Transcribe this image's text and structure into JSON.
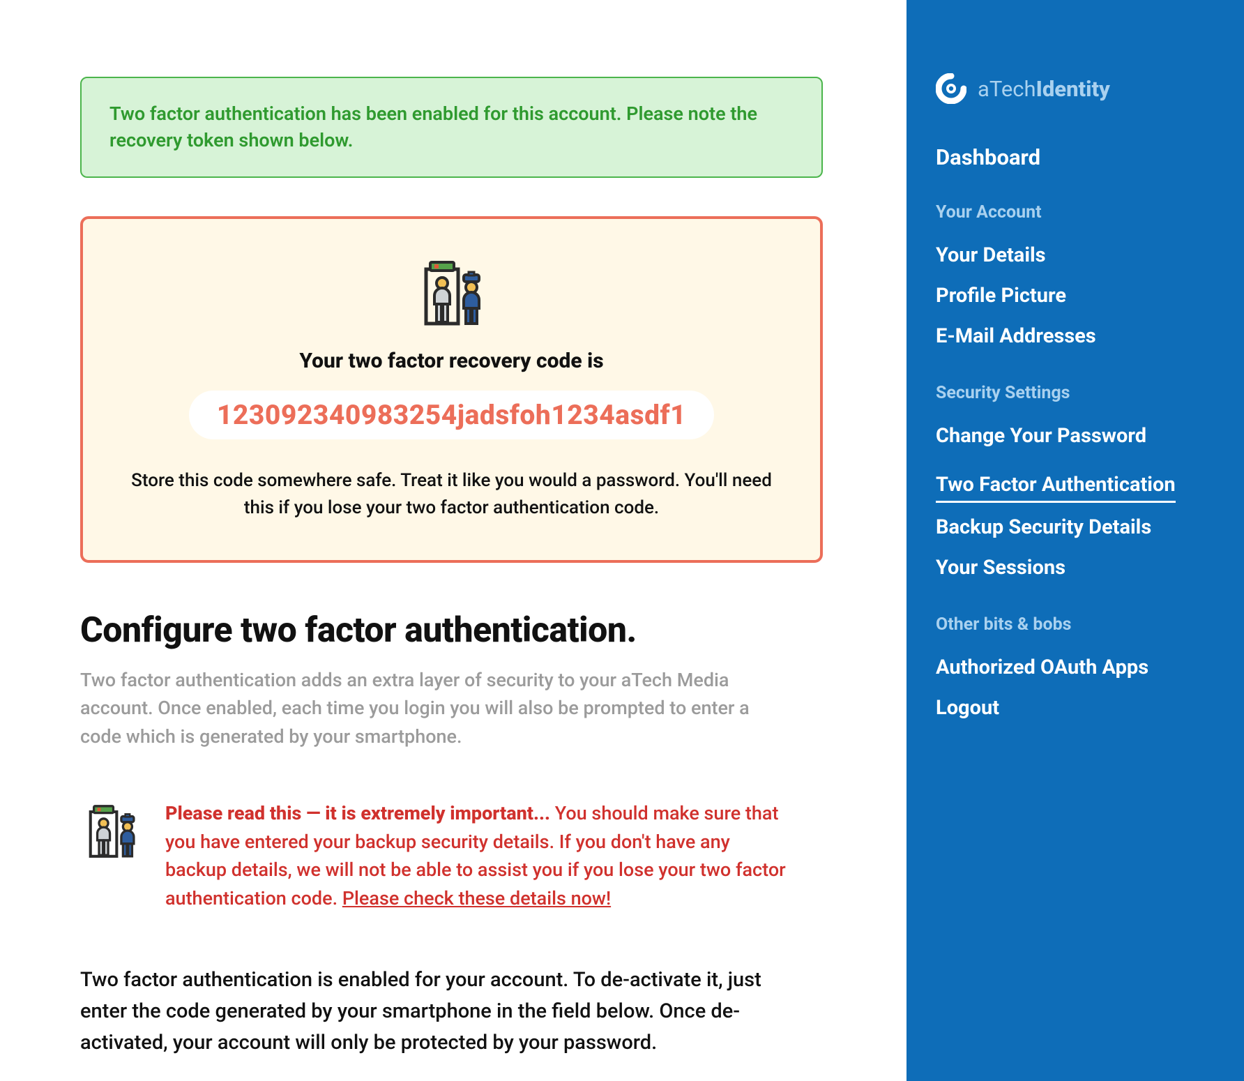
{
  "alert": {
    "text": "Two factor authentication has been enabled for this account. Please note the recovery token shown below."
  },
  "recovery": {
    "title": "Your two factor recovery code is",
    "code": "123092340983254jadsfoh1234asdf1",
    "note": "Store this code somewhere safe. Treat it like you would a password. You'll need this if you lose your two factor authentication code."
  },
  "page": {
    "title": "Configure two factor authentication.",
    "intro": "Two factor authentication adds an extra layer of security to your aTech Media account. Once enabled, each time you login you will also be prompted to enter a code which is generated by your smartphone."
  },
  "warn": {
    "lead": "Please read this — it is extremely important...",
    "body": " You should make sure that you have entered your backup security details. If you don't have any backup details, we will not be able to assist you if you lose your two factor authentication code. ",
    "link": "Please check these details now!"
  },
  "deactivate": {
    "text": "Two factor authentication is enabled for your account. To de-activate it, just enter the code generated by your smartphone in the field below. Once de-activated, your account will only be protected by your password."
  },
  "sidebar": {
    "brand_a": "aTech",
    "brand_b": "Identity",
    "dashboard": "Dashboard",
    "sections": {
      "account": {
        "label": "Your Account",
        "items": [
          "Your Details",
          "Profile Picture",
          "E-Mail Addresses"
        ]
      },
      "security": {
        "label": "Security Settings",
        "items": [
          "Change Your Password",
          "Two Factor Authentication",
          "Backup Security Details",
          "Your Sessions"
        ]
      },
      "other": {
        "label": "Other bits & bobs",
        "items": [
          "Authorized OAuth Apps",
          "Logout"
        ]
      }
    }
  }
}
